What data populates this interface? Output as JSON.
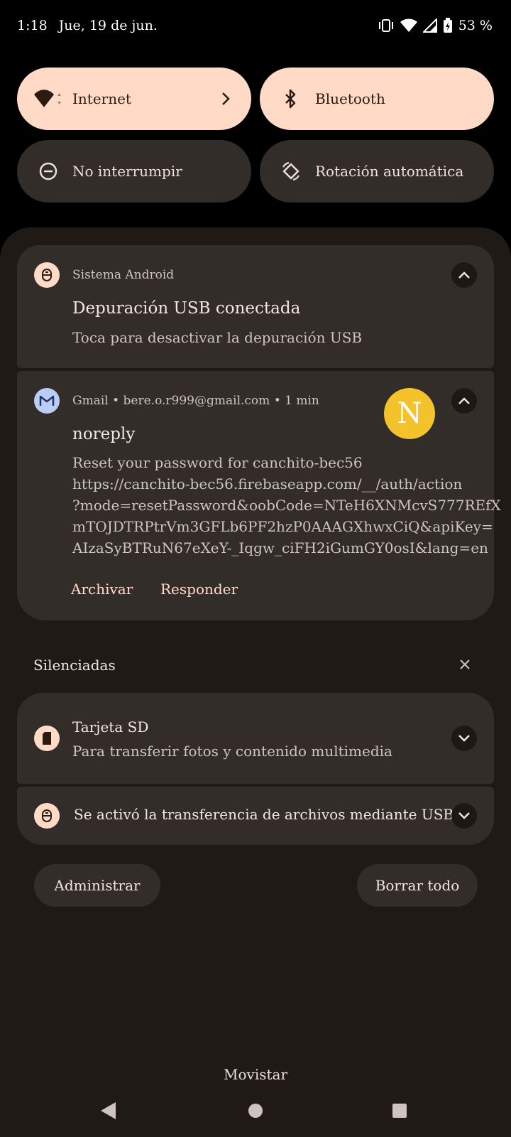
{
  "status_bar": {
    "time": "1:18",
    "date": "Jue, 19 de jun.",
    "battery": "53 %",
    "icons": [
      "vibrate-icon",
      "wifi-icon",
      "cell-signal-icon",
      "battery-charging-icon"
    ]
  },
  "quick_settings": {
    "tiles": [
      {
        "label": "Internet",
        "icon": "wifi-icon",
        "active": true
      },
      {
        "label": "Bluetooth",
        "icon": "bluetooth-icon",
        "active": true
      },
      {
        "label": "No interrumpir",
        "icon": "do-not-disturb-icon",
        "active": false
      },
      {
        "label": "Rotación automática",
        "icon": "auto-rotate-icon",
        "active": false
      }
    ]
  },
  "notifications": {
    "usb_debug": {
      "app": "Sistema Android",
      "title": "Depuración USB conectada",
      "text": "Toca para desactivar la depuración USB"
    },
    "gmail": {
      "header": "Gmail • bere.o.r999@gmail.com • 1 min",
      "avatar_letter": "N",
      "title": "noreply",
      "body_lines": [
        "Reset your password for canchito-bec56",
        "https://canchito-bec56.firebaseapp.com/__/auth/action",
        "?mode=resetPassword&oobCode=NTeH6XNMcvS777REfX",
        "mTOJDTRPtrVm3GFLb6PF2hzP0AAAGXhwxCiQ&apiKey=",
        "AIzaSyBTRuN67eXeY-_Iqgw_ciFH2iGumGY0osI&lang=en"
      ],
      "actions": [
        "Archivar",
        "Responder"
      ]
    }
  },
  "silenced": {
    "title": "Silenciadas",
    "sd_card": {
      "title": "Tarjeta SD",
      "text": "Para transferir fotos y contenido multimedia"
    },
    "usb_transfer": {
      "title": "Se activó la transferencia de archivos mediante USB"
    }
  },
  "buttons": {
    "manage": "Administrar",
    "clear_all": "Borrar todo"
  },
  "carrier": "Movistar",
  "colors": {
    "accent": "#ffdbc7",
    "card": "#332d2a",
    "shade": "#201a17",
    "avatar": "#f4c22b"
  }
}
